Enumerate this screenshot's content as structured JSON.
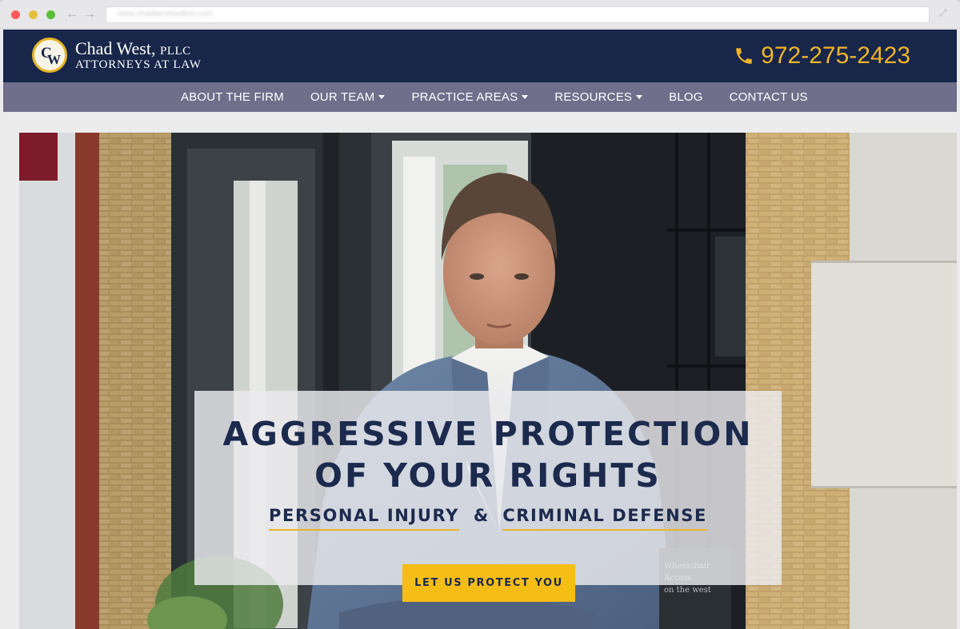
{
  "browser": {
    "url": "www.chadwestlawfirm.com"
  },
  "header": {
    "logo_letters": {
      "c": "C",
      "w": "W"
    },
    "firm_name": "Chad West,",
    "firm_suffix": "PLLC",
    "tagline": "ATTORNEYS AT LAW",
    "phone_icon": "phone-icon",
    "phone": "972-275-2423"
  },
  "nav": {
    "items": [
      {
        "label": "ABOUT THE FIRM",
        "dropdown": false
      },
      {
        "label": "OUR TEAM",
        "dropdown": true
      },
      {
        "label": "PRACTICE AREAS",
        "dropdown": true
      },
      {
        "label": "RESOURCES",
        "dropdown": true
      },
      {
        "label": "BLOG",
        "dropdown": false
      },
      {
        "label": "CONTACT US",
        "dropdown": false
      }
    ]
  },
  "hero": {
    "headline_line1": "AGGRESSIVE PROTECTION",
    "headline_line2": "OF YOUR RIGHTS",
    "practice_1": "PERSONAL INJURY",
    "ampersand": "&",
    "practice_2": "CRIMINAL DEFENSE",
    "cta_label": "LET US PROTECT YOU",
    "photo_sign_text": "Wheelchair Access on the west"
  },
  "colors": {
    "header_bg": "#18264a",
    "nav_bg": "#6f6f8c",
    "accent_gold": "#f0b428",
    "cta_bg": "#f6bd16",
    "text_navy": "#1b2a4d"
  }
}
